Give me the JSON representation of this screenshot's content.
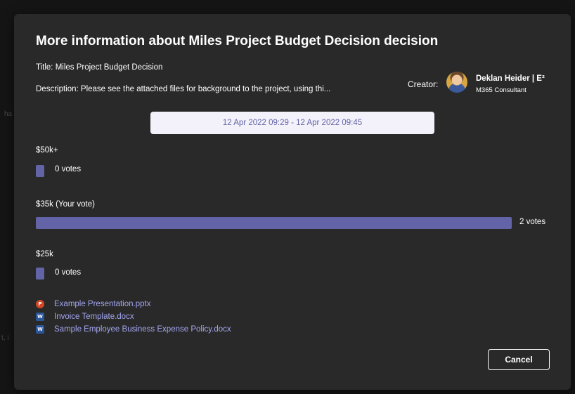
{
  "backdrop": {
    "fragment_1": "ha",
    "fragment_2": "t, i"
  },
  "dialog": {
    "title": "More information about Miles Project Budget Decision decision",
    "title_line": "Title: Miles Project Budget Decision",
    "description_line": "Description:  Please see the attached files for background to the project, using thi...",
    "creator": {
      "label": "Creator:",
      "name": "Deklan Heider | E²",
      "role": "M365 Consultant"
    },
    "date_range": "12 Apr 2022 09:29 - 12 Apr 2022 09:45",
    "options": [
      {
        "label": "$50k+",
        "votes_text": "0 votes",
        "fraction": 0
      },
      {
        "label": "$35k  (Your vote)",
        "votes_text": "2 votes",
        "fraction": 1
      },
      {
        "label": "$25k",
        "votes_text": "0 votes",
        "fraction": 0
      }
    ],
    "attachments": [
      {
        "name": "Example Presentation.pptx",
        "icon": "powerpoint-icon"
      },
      {
        "name": "Invoice Template.docx",
        "icon": "word-icon"
      },
      {
        "name": "Sample Employee Business Expense Policy.docx",
        "icon": "word-icon"
      }
    ],
    "cancel_label": "Cancel"
  },
  "colors": {
    "accent": "#6264a7",
    "link": "#a3a6f0",
    "dialog_bg": "#292929"
  }
}
